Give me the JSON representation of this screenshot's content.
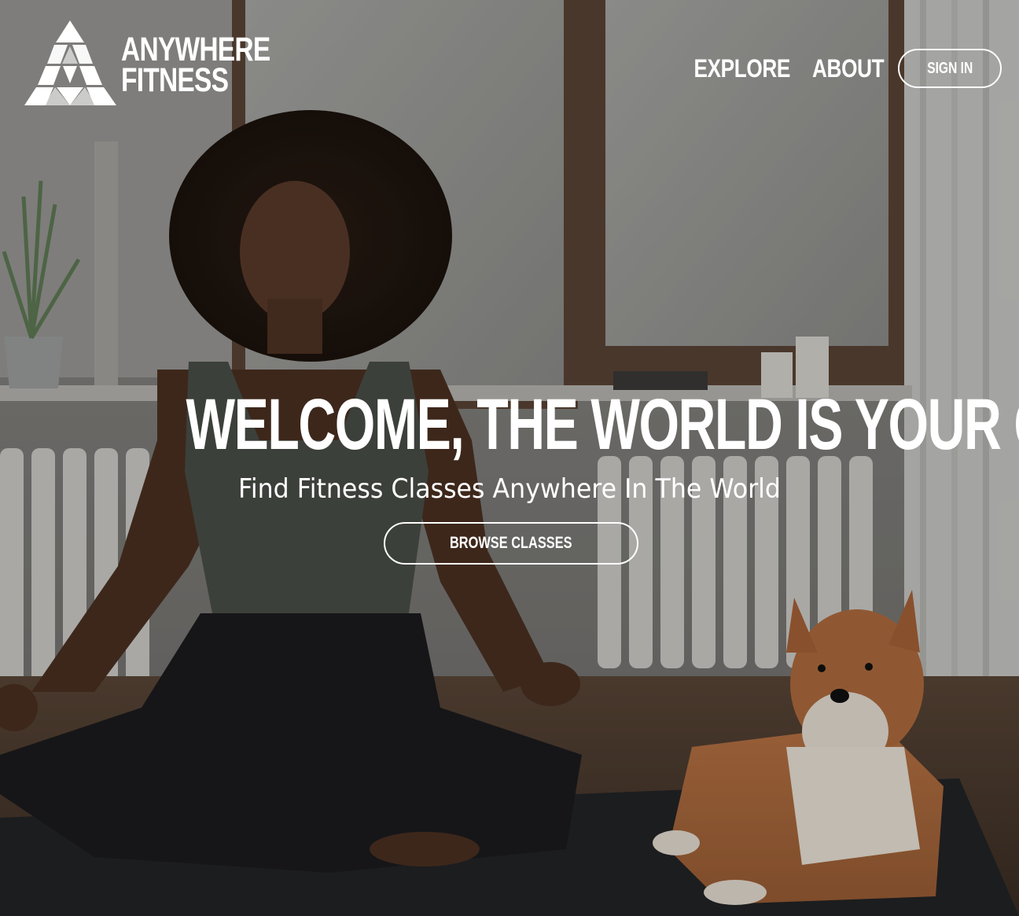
{
  "brand": {
    "name_line1": "ANYWHERE",
    "name_line2": "FITNESS",
    "logo_icon": "triangle-logo-icon"
  },
  "nav": {
    "explore_label": "EXPLORE",
    "about_label": "ABOUT",
    "signin_label": "SIGN IN"
  },
  "hero": {
    "headline": "WELCOME, THE WORLD IS YOUR GYM.",
    "subheadline": "Find Fitness Classes Anywhere In The World",
    "cta_label": "BROWSE CLASSES",
    "background_image": "woman meditating on yoga mat beside shiba inu dog"
  },
  "colors": {
    "text": "#ffffff",
    "button_border": "#ffffff"
  }
}
